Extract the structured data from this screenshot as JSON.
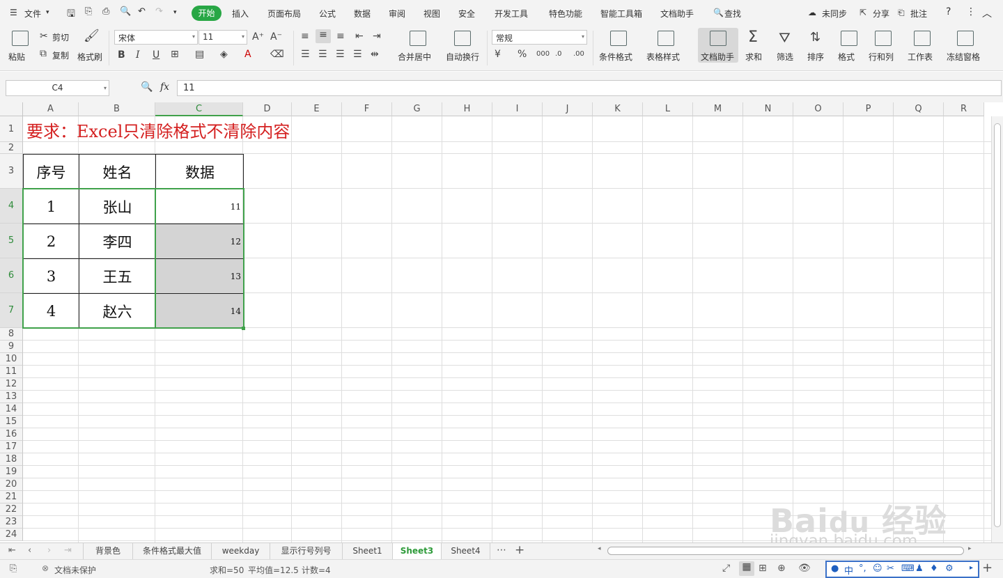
{
  "menu": {
    "file": "文件",
    "tabs": [
      "开始",
      "插入",
      "页面布局",
      "公式",
      "数据",
      "审阅",
      "视图",
      "安全",
      "开发工具",
      "特色功能",
      "智能工具箱",
      "文档助手"
    ],
    "search": "查找",
    "unsync": "未同步",
    "share": "分享",
    "annotate": "批注"
  },
  "ribbon": {
    "paste": "粘贴",
    "cut": "剪切",
    "copy": "复制",
    "format_painter": "格式刷",
    "font_name": "宋体",
    "font_size": "11",
    "merge_center": "合并居中",
    "wrap_text": "自动换行",
    "number_format": "常规",
    "cond_format": "条件格式",
    "table_style": "表格样式",
    "doc_assistant": "文档助手",
    "sum": "求和",
    "filter": "筛选",
    "sort": "排序",
    "format": "格式",
    "row_col": "行和列",
    "worksheet": "工作表",
    "freeze": "冻结窗格"
  },
  "formula_bar": {
    "name_box": "C4",
    "fx": "fx",
    "value": "11"
  },
  "columns": [
    "A",
    "B",
    "C",
    "D",
    "E",
    "F",
    "G",
    "H",
    "I",
    "J",
    "K",
    "L",
    "M",
    "N",
    "O",
    "P",
    "Q",
    "R"
  ],
  "rows": [
    "1",
    "2",
    "3",
    "4",
    "5",
    "6",
    "7",
    "8",
    "9",
    "10",
    "11",
    "12",
    "13",
    "14",
    "15",
    "16",
    "17",
    "18",
    "19",
    "20",
    "21",
    "22",
    "23",
    "24"
  ],
  "sheet": {
    "title": "要求：Excel只清除格式不清除内容",
    "headers": [
      "序号",
      "姓名",
      "数据"
    ],
    "data": [
      {
        "no": "1",
        "name": "张山",
        "value": "11"
      },
      {
        "no": "2",
        "name": "李四",
        "value": "12"
      },
      {
        "no": "3",
        "name": "王五",
        "value": "13"
      },
      {
        "no": "4",
        "name": "赵六",
        "value": "14"
      }
    ]
  },
  "sheet_tabs": [
    "背景色",
    "条件格式最大值",
    "weekday",
    "显示行号列号",
    "Sheet1",
    "Sheet3",
    "Sheet4"
  ],
  "active_sheet": "Sheet3",
  "status": {
    "protect": "文档未保护",
    "sum": "求和=50",
    "avg": "平均值=12.5",
    "count": "计数=4"
  },
  "watermark": "jingyan.baidu.com",
  "colors": {
    "accent": "#28a745",
    "title_red": "#d42020",
    "selection": "#2e9b3a",
    "selected_fill": "#d4d4d4"
  }
}
